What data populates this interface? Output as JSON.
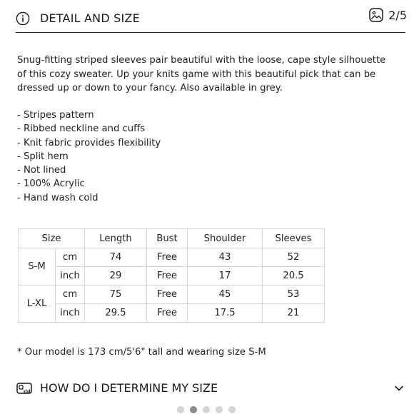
{
  "header": {
    "title": "DETAIL AND SIZE",
    "counter": "2/5",
    "info_icon": "info-circle-icon",
    "counter_icon": "image-gallery-icon"
  },
  "description": "Snug-fitting striped sleeves pair beautiful with the loose, cape style silhouette of this cozy sweater. Up your knits game with this beautiful pick that can be dressed up or down to your fancy. Also available in grey.",
  "features": [
    "- Stripes pattern",
    "- Ribbed neckline and cuffs",
    "- Knit fabric provides flexibility",
    "- Split hem",
    "- Not lined",
    "- 100% Acrylic",
    "- Hand wash cold"
  ],
  "size_table": {
    "headers": [
      "Size",
      "Length",
      "Bust",
      "Shoulder",
      "Sleeves"
    ],
    "groups": [
      {
        "size": "S-M",
        "rows": [
          [
            "cm",
            "74",
            "Free",
            "43",
            "52"
          ],
          [
            "inch",
            "29",
            "Free",
            "17",
            "20.5"
          ]
        ]
      },
      {
        "size": "L-XL",
        "rows": [
          [
            "cm",
            "75",
            "Free",
            "45",
            "53"
          ],
          [
            "inch",
            "29.5",
            "Free",
            "17.5",
            "21"
          ]
        ]
      }
    ]
  },
  "model_note": "* Our model is 173 cm/5'6\" tall and wearing size S-M",
  "how_section": {
    "title": "HOW DO I DETERMINE MY SIZE",
    "icon": "ruler-icon",
    "expand_icon": "chevron-down-icon"
  },
  "pagination": {
    "count": 5,
    "active_index": 1
  }
}
